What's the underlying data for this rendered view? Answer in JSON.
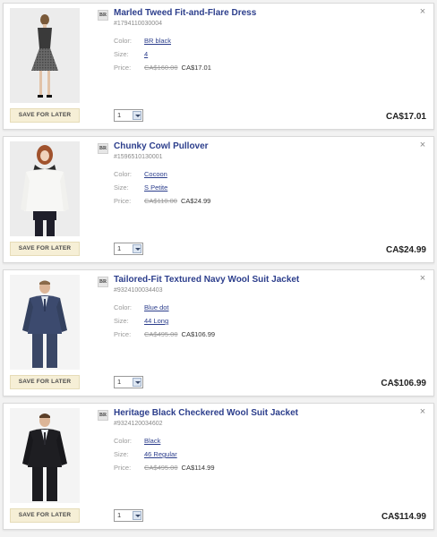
{
  "items": [
    {
      "brand": "BR",
      "title": "Marled Tweed Fit-and-Flare Dress",
      "sku": "#1794110030004",
      "color_label": "Color:",
      "color": "BR black",
      "size_label": "Size:",
      "size": "4",
      "price_label": "Price:",
      "original_price": "CA$160.00",
      "sale_price": "CA$17.01",
      "quantity": "1",
      "total": "CA$17.01",
      "save_label": "SAVE FOR LATER",
      "close": "×"
    },
    {
      "brand": "BR",
      "title": "Chunky Cowl Pullover",
      "sku": "#1596510130001",
      "color_label": "Color:",
      "color": "Cocoon",
      "size_label": "Size:",
      "size": "S Petite",
      "price_label": "Price:",
      "original_price": "CA$110.00",
      "sale_price": "CA$24.99",
      "quantity": "1",
      "total": "CA$24.99",
      "save_label": "SAVE FOR LATER",
      "close": "×"
    },
    {
      "brand": "BR",
      "title": "Tailored-Fit Textured Navy Wool Suit Jacket",
      "sku": "#9324100034403",
      "color_label": "Color:",
      "color": "Blue dot",
      "size_label": "Size:",
      "size": "44 Long",
      "price_label": "Price:",
      "original_price": "CA$495.00",
      "sale_price": "CA$106.99",
      "quantity": "1",
      "total": "CA$106.99",
      "save_label": "SAVE FOR LATER",
      "close": "×"
    },
    {
      "brand": "BR",
      "title": "Heritage Black Checkered Wool Suit Jacket",
      "sku": "#9324120034602",
      "color_label": "Color:",
      "color": "Black",
      "size_label": "Size:",
      "size": "46 Regular",
      "price_label": "Price:",
      "original_price": "CA$495.00",
      "sale_price": "CA$114.99",
      "quantity": "1",
      "total": "CA$114.99",
      "save_label": "SAVE FOR LATER",
      "close": "×"
    }
  ],
  "colors": {
    "link": "#2c3e8c",
    "save_button_bg": "#f6efd6"
  }
}
